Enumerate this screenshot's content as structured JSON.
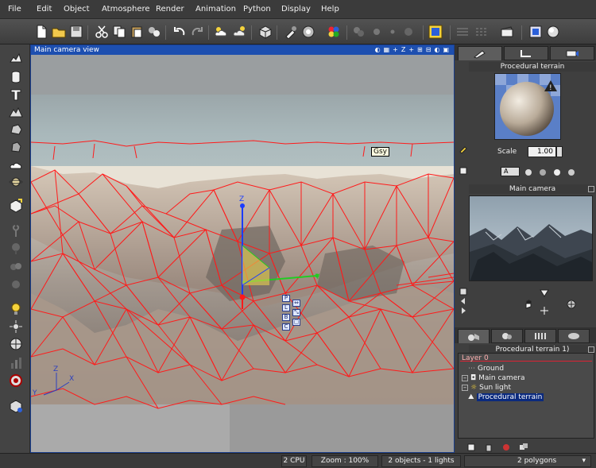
{
  "menu": [
    "File",
    "Edit",
    "Object",
    "Atmosphere",
    "Render",
    "Animation",
    "Python",
    "Display",
    "Help"
  ],
  "viewport": {
    "title": "Main camera view",
    "buttons": [
      "◐",
      "▦",
      "+",
      "Z",
      "+",
      "⊞",
      "⊟",
      "◐",
      "▣"
    ],
    "tooltip": "Gsy",
    "axis_labels": {
      "y": "Y",
      "z": "Z",
      "x": "X"
    },
    "anchor_labels": [
      "P",
      "L",
      "B",
      "C"
    ]
  },
  "right_panel": {
    "material_title": "Procedural terrain",
    "scale_label": "Scale",
    "scale_value": "1.00",
    "mode_label": "A",
    "camera_title": "Main camera",
    "tree_title": "Procedural terrain 1)",
    "tree_items": [
      {
        "label": "Layer 0",
        "type": "layer"
      },
      {
        "label": "Ground",
        "type": "item"
      },
      {
        "label": "Main camera",
        "type": "item"
      },
      {
        "label": "Sun light",
        "type": "item"
      },
      {
        "label": "Procedural terrain",
        "type": "item",
        "selected": true
      }
    ]
  },
  "status": {
    "cpu": "2 CPU",
    "zoom": "Zoom : 100%",
    "objects": "2 objects - 1 lights",
    "polygons": "2 polygons"
  },
  "colors": {
    "selection_wire": "#ff1a1a",
    "viewport_title": "#1d4fb0"
  }
}
